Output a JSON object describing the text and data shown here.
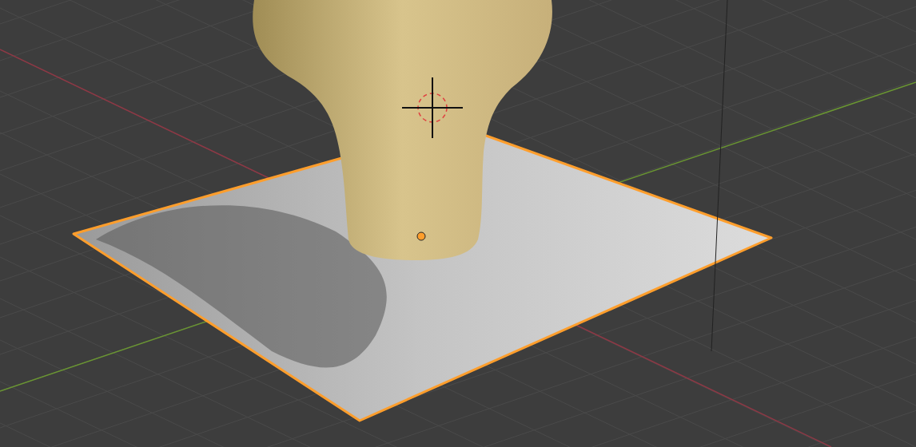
{
  "viewport": {
    "objects": [
      {
        "kind": "plane",
        "selected": true
      },
      {
        "kind": "sculpture",
        "selected": false
      }
    ]
  }
}
